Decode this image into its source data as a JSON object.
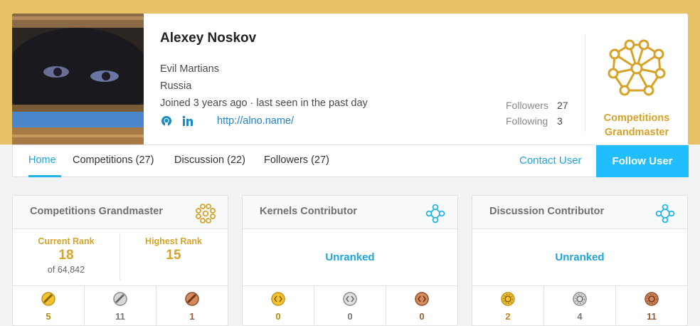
{
  "profile": {
    "name": "Alexey Noskov",
    "organization": "Evil Martians",
    "location": "Russia",
    "joined": "Joined 3 years ago · last seen in the past day",
    "url": "http://alno.name/",
    "followers_label": "Followers",
    "followers_count": "27",
    "following_label": "Following",
    "following_count": "3",
    "tier_line1": "Competitions",
    "tier_line2": "Grandmaster"
  },
  "tabs": [
    {
      "label": "Home"
    },
    {
      "label": "Competitions (27)"
    },
    {
      "label": "Discussion (22)"
    },
    {
      "label": "Followers (27)"
    }
  ],
  "actions": {
    "contact": "Contact User",
    "follow": "Follow User"
  },
  "tiles": [
    {
      "title": "Competitions Grandmaster",
      "current_rank_label": "Current Rank",
      "current_rank": "18",
      "current_rank_of": "of 64,842",
      "highest_rank_label": "Highest Rank",
      "highest_rank": "15",
      "medals": {
        "gold": "5",
        "silver": "11",
        "bronze": "1"
      }
    },
    {
      "title": "Kernels Contributor",
      "status": "Unranked",
      "medals": {
        "gold": "0",
        "silver": "0",
        "bronze": "0"
      }
    },
    {
      "title": "Discussion Contributor",
      "status": "Unranked",
      "medals": {
        "gold": "2",
        "silver": "4",
        "bronze": "11"
      }
    }
  ],
  "colors": {
    "banner": "#e6c167",
    "accent": "#20beff",
    "tier_gold": "#d6a22a"
  }
}
